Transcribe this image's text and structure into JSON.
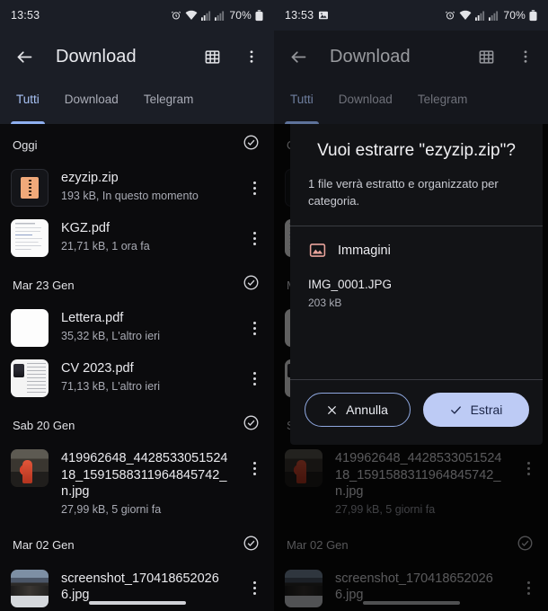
{
  "status_bar": {
    "time": "13:53",
    "battery_percent": "70%",
    "icons_left_extra": "screenshot-image-icon",
    "icons_right": [
      "alarm-icon",
      "wifi-icon",
      "signal-sim1-icon",
      "signal-sim2-icon",
      "battery-icon"
    ]
  },
  "app_bar": {
    "title": "Download",
    "back_icon": "back-arrow-icon",
    "grid_icon": "grid-view-icon",
    "overflow_icon": "more-vertical-icon"
  },
  "tabs": [
    {
      "label": "Tutti",
      "active": true
    },
    {
      "label": "Download",
      "active": false
    },
    {
      "label": "Telegram",
      "active": false
    }
  ],
  "sections": [
    {
      "label": "Oggi",
      "check_icon": "check-circle-icon",
      "files": [
        {
          "name": "ezyzip.zip",
          "meta": "193 kB, In questo momento",
          "thumb": "zip"
        },
        {
          "name": "KGZ.pdf",
          "meta": "21,71 kB, 1 ora fa",
          "thumb": "doc"
        }
      ]
    },
    {
      "label": "Mar 23 Gen",
      "check_icon": "check-circle-icon",
      "files": [
        {
          "name": "Lettera.pdf",
          "meta": "35,32 kB, L'altro ieri",
          "thumb": "blank"
        },
        {
          "name": "CV 2023.pdf",
          "meta": "71,13 kB, L'altro ieri",
          "thumb": "cv"
        }
      ]
    },
    {
      "label": "Sab 20 Gen",
      "check_icon": "check-circle-icon",
      "files": [
        {
          "name": "419962648_442853305152418_1591588311964845742_n.jpg",
          "meta": "27,99 kB, 5 giorni fa",
          "thumb": "photo1"
        }
      ]
    },
    {
      "label": "Mar 02 Gen",
      "check_icon": "check-circle-icon",
      "files": [
        {
          "name": "screenshot_1704186520266.jpg",
          "meta": "",
          "thumb": "photo2"
        }
      ]
    }
  ],
  "dialog": {
    "title": "Vuoi estrarre \"ezyzip.zip\"?",
    "subtitle": "1 file verrà estratto e organizzato per categoria.",
    "category": {
      "icon": "image-category-icon",
      "label": "Immagini",
      "file_name": "IMG_0001.JPG",
      "file_size": "203 kB"
    },
    "cancel_label": "Annulla",
    "confirm_label": "Estrai",
    "cancel_icon": "close-x-icon",
    "confirm_icon": "check-icon"
  },
  "colors": {
    "accent": "#a9c3f5",
    "confirm_fill": "#bdcbf5",
    "confirm_text": "#1b2547",
    "surface": "#121316",
    "chrome": "#1b1e26",
    "category_icon": "#e8a39b"
  },
  "nav": {
    "handle": "home-gesture-handle"
  }
}
